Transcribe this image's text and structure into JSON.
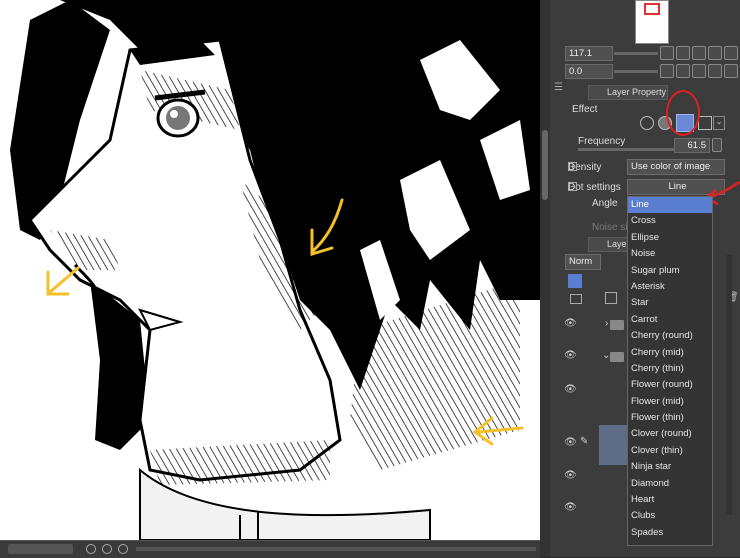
{
  "app": {
    "accent": "#5a7fd0",
    "annotation_color": "#f5c02a",
    "circle_color": "#e02020"
  },
  "navigator": {
    "zoom": "117.1",
    "rotation": "0.0"
  },
  "layer_property": {
    "tab_label": "Layer Property",
    "effect_label": "Effect",
    "frequency_label": "Frequency",
    "frequency_value": "61.5",
    "density_label": "Density",
    "density_value": "Use color of image",
    "dot_settings_label": "Dot settings",
    "dot_settings_value": "Line",
    "angle_label": "Angle",
    "noise_size_label": "Noise si"
  },
  "layer_panel": {
    "tab_label": "Layer",
    "blend_mode": "Norm"
  },
  "dot_menu": {
    "items": [
      "Line",
      "Cross",
      "Ellipse",
      "Noise",
      "Sugar plum",
      "Asterisk",
      "Star",
      "Carrot",
      "Cherry (round)",
      "Cherry (mid)",
      "Cherry (thin)",
      "Flower (round)",
      "Flower (mid)",
      "Flower (thin)",
      "Clover (round)",
      "Clover (thin)",
      "Ninja star",
      "Diamond",
      "Heart",
      "Clubs",
      "Spades"
    ],
    "selected": "Line"
  }
}
